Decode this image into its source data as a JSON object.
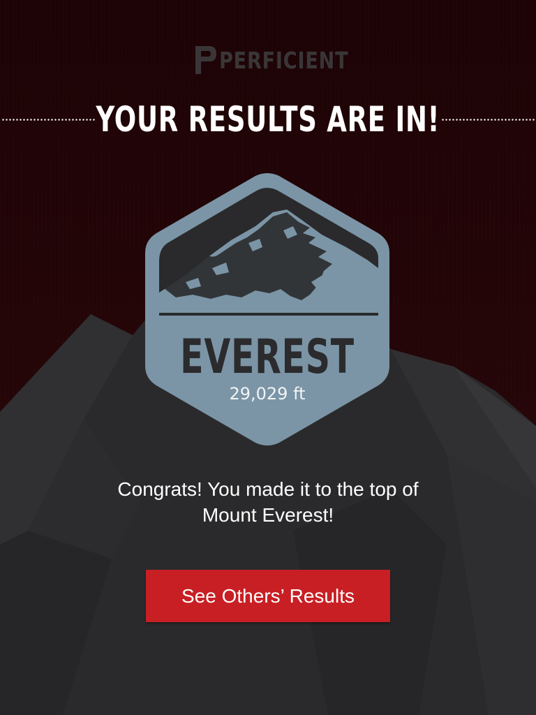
{
  "brand": {
    "name": "PERFICIENT",
    "icon": "perficient-logo"
  },
  "header": {
    "title": "YOUR RESULTS ARE IN!"
  },
  "badge": {
    "peak": "EVEREST",
    "elevation": "29,029 ft",
    "icon": "mountain-hexagon-badge"
  },
  "result": {
    "line1": "Congrats! You made it to the top of",
    "line2": "Mount Everest!"
  },
  "actions": {
    "see_others_label": "See Others’ Results"
  },
  "colors": {
    "background": "#200406",
    "mountain": "#2a2a2c",
    "badge": "#7b95a6",
    "accent": "#c81f24",
    "text": "#ffffff"
  }
}
